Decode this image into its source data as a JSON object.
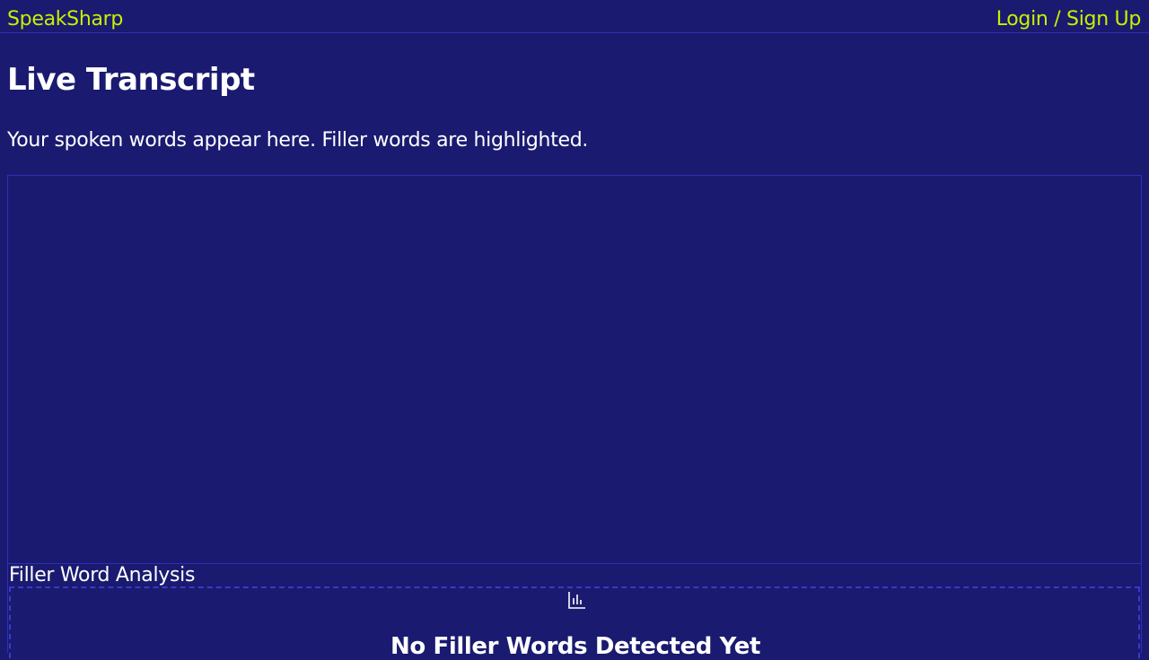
{
  "header": {
    "brand": "SpeakSharp",
    "login_label": "Login / Sign Up"
  },
  "main": {
    "title": "Live Transcript",
    "subtitle": "Your spoken words appear here. Filler words are highlighted.",
    "transcript_text": ""
  },
  "analysis": {
    "title": "Filler Word Analysis",
    "empty_icon": "bar-chart-icon",
    "empty_heading": "No Filler Words Detected Yet"
  },
  "colors": {
    "background": "#1a1a70",
    "accent": "#c8f000",
    "border": "#2e2eb8",
    "text": "#ffffff"
  }
}
